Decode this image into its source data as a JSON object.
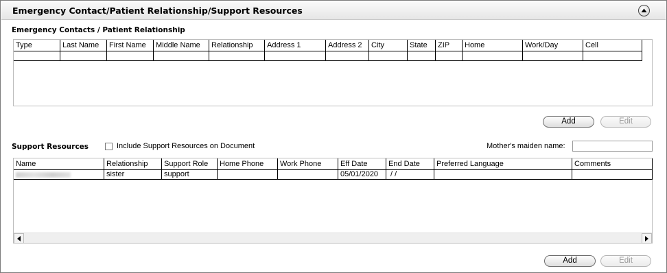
{
  "header": {
    "title": "Emergency Contact/Patient Relationship/Support Resources"
  },
  "emergency": {
    "section_title": "Emergency Contacts / Patient Relationship",
    "columns": [
      "Type",
      "Last Name",
      "First Name",
      "Middle Name",
      "Relationship",
      "Address 1",
      "Address 2",
      "City",
      "State",
      "ZIP",
      "Home",
      "Work/Day",
      "Cell"
    ],
    "add_label": "Add",
    "edit_label": "Edit"
  },
  "support": {
    "section_title": "Support Resources",
    "include_label": "Include Support Resources on Document",
    "include_checked": false,
    "maiden_label": "Mother's maiden name:",
    "maiden_value": "",
    "columns": [
      "Name",
      "Relationship",
      "Support Role",
      "Home Phone",
      "Work Phone",
      "Eff Date",
      "End Date",
      "Preferred Language",
      "Comments"
    ],
    "rows": [
      {
        "name": "",
        "relationship": "sister",
        "support_role": "support",
        "home_phone": "",
        "work_phone": "",
        "eff_date": "05/01/2020",
        "end_date": " / /",
        "preferred_language": "",
        "comments": ""
      }
    ],
    "add_label": "Add",
    "edit_label": "Edit"
  },
  "icons": {
    "collapse": "chevron-up-circle-icon",
    "scroll_left": "arrow-left-icon",
    "scroll_right": "arrow-right-icon"
  }
}
